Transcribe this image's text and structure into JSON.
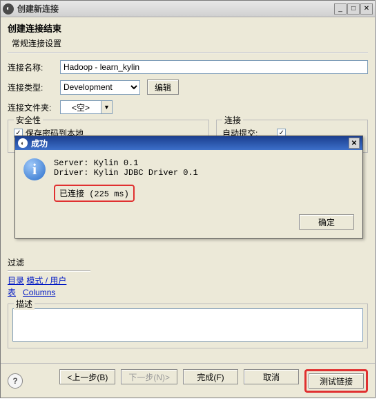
{
  "window": {
    "title": "创建新连接"
  },
  "page": {
    "heading": "创建连接结束",
    "subheading": "常规连接设置"
  },
  "form": {
    "name_label": "连接名称:",
    "name_value": "Hadoop - learn_kylin",
    "type_label": "连接类型:",
    "type_value": "Development",
    "edit_button": "编辑",
    "folder_label": "连接文件夹:",
    "folder_value": "<空>"
  },
  "security": {
    "legend": "安全性",
    "save_password": "保存密码到本地",
    "checked": "✓"
  },
  "connection": {
    "legend": "连接",
    "autocommit": "自动提交:",
    "checked": "✓"
  },
  "modal": {
    "title": "成功",
    "server_line": "Server: Kylin 0.1",
    "driver_line": "Driver: Kylin JDBC Driver 0.1",
    "status": "已连接 (225 ms)",
    "ok": "确定"
  },
  "filter": {
    "label": "过滤",
    "link1": "目录",
    "link2": "模式 / 用户",
    "link3": "表",
    "link4": "Columns"
  },
  "description": {
    "legend": "描述"
  },
  "footer": {
    "back": "<上一步(B)",
    "next": "下一步(N)>",
    "finish": "完成(F)",
    "cancel": "取消",
    "test": "测试链接"
  }
}
